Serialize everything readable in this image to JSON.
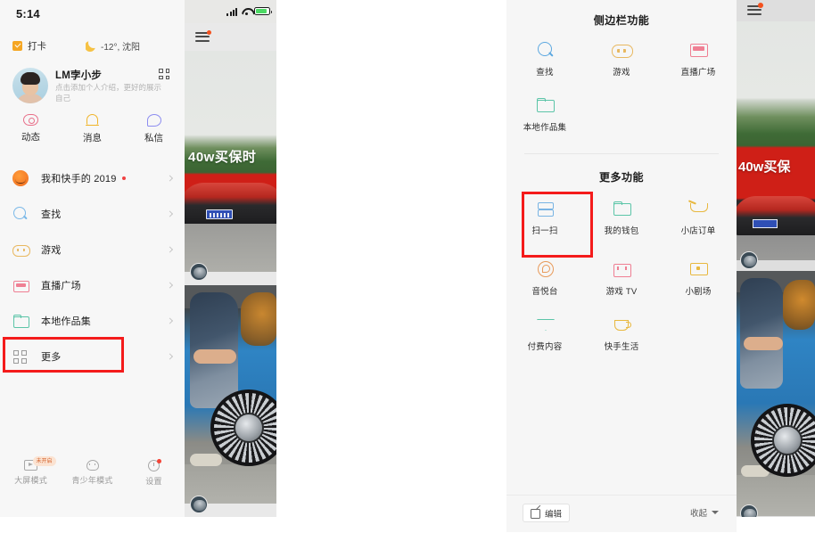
{
  "left_phone": {
    "status_bar": {
      "time": "5:14",
      "signal_icon": "cellular-signal-icon",
      "wifi_icon": "wifi-icon",
      "battery_icon": "battery-icon"
    },
    "top_row": {
      "punch_label": "打卡",
      "punch_icon": "checkbox-icon",
      "weather_icon": "moon-icon",
      "weather_label": "-12°, 沈阳"
    },
    "profile": {
      "username": "LM孛小步",
      "bio": "点击添加个人介绍，更好的展示自己",
      "qr_icon": "qr-code-icon",
      "avatar": "user-avatar"
    },
    "actions": [
      {
        "label": "动态",
        "icon": "eye-icon"
      },
      {
        "label": "消息",
        "icon": "bell-icon"
      },
      {
        "label": "私信",
        "icon": "chat-bubble-icon"
      }
    ],
    "menu": [
      {
        "label": "我和快手的 2019",
        "icon": "pumpkin-icon",
        "dot": true,
        "chevron": true
      },
      {
        "label": "查找",
        "icon": "search-icon",
        "dot": false,
        "chevron": true
      },
      {
        "label": "游戏",
        "icon": "game-controller-icon",
        "dot": false,
        "chevron": true
      },
      {
        "label": "直播广场",
        "icon": "live-tv-icon",
        "dot": false,
        "chevron": true
      },
      {
        "label": "本地作品集",
        "icon": "folder-icon",
        "dot": false,
        "chevron": true
      },
      {
        "label": "更多",
        "icon": "grid-more-icon",
        "dot": false,
        "chevron": true
      }
    ],
    "bottom_bar": [
      {
        "label": "大屏模式",
        "icon": "tv-play-icon",
        "badge": "未开启"
      },
      {
        "label": "青少年模式",
        "icon": "teen-mode-icon",
        "badge": ""
      },
      {
        "label": "设置",
        "icon": "gear-icon",
        "badge": "",
        "red_dot": true
      }
    ],
    "feed": {
      "menu_icon": "hamburger-menu-icon",
      "post1_caption": "40w买保时",
      "post1_thumb": "car-photo",
      "post2_thumb": "wheel-photo"
    }
  },
  "right_phone": {
    "section1": {
      "title": "侧边栏功能",
      "items": [
        {
          "label": "查找",
          "icon": "search-icon"
        },
        {
          "label": "游戏",
          "icon": "game-controller-icon"
        },
        {
          "label": "直播广场",
          "icon": "live-tv-icon"
        },
        {
          "label": "本地作品集",
          "icon": "folder-icon"
        }
      ]
    },
    "section2": {
      "title": "更多功能",
      "items": [
        {
          "label": "扫一扫",
          "icon": "scan-icon"
        },
        {
          "label": "我的钱包",
          "icon": "wallet-icon"
        },
        {
          "label": "小店订单",
          "icon": "shopping-cart-icon"
        },
        {
          "label": "音悦台",
          "icon": "music-icon"
        },
        {
          "label": "游戏 TV",
          "icon": "game-tv-icon"
        },
        {
          "label": "小剧场",
          "icon": "theater-screen-icon"
        },
        {
          "label": "付费内容",
          "icon": "diamond-icon"
        },
        {
          "label": "快手生活",
          "icon": "coffee-cup-icon"
        }
      ]
    },
    "bottom_bar": {
      "edit_label": "编辑",
      "edit_icon": "pencil-square-icon",
      "collapse_label": "收起",
      "collapse_icon": "caret-down-icon"
    },
    "feed": {
      "menu_icon": "hamburger-menu-icon",
      "post1_caption": "40w买保",
      "post1_thumb": "car-photo",
      "post2_thumb": "wheel-photo"
    }
  },
  "annotations": {
    "highlight_color": "#f41b1b",
    "left_target": "更多",
    "right_target": "扫一扫"
  }
}
